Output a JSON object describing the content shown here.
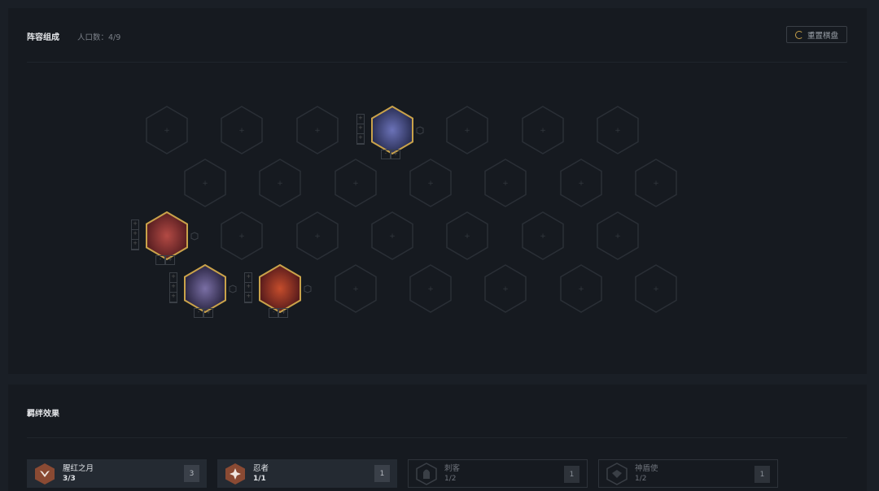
{
  "board": {
    "title": "阵容组成",
    "population_label": "人口数：4/9",
    "reset_label": "重置棋盘",
    "units": [
      {
        "name": "unit-1",
        "star": 1
      },
      {
        "name": "unit-2",
        "star": 1
      },
      {
        "name": "unit-3",
        "star": 1
      },
      {
        "name": "unit-4",
        "star": 1
      }
    ]
  },
  "traits": {
    "title": "羁绊效果",
    "items": [
      {
        "name": "腥红之月",
        "count": "3/3",
        "level": "3",
        "active": true,
        "icon": "moon-emblem-icon"
      },
      {
        "name": "忍者",
        "count": "1/1",
        "level": "1",
        "active": true,
        "icon": "shuriken-icon"
      },
      {
        "name": "刺客",
        "count": "1/2",
        "level": "1",
        "active": false,
        "icon": "assassin-icon"
      },
      {
        "name": "神盾使",
        "count": "1/2",
        "level": "1",
        "active": false,
        "icon": "aegis-icon"
      }
    ]
  },
  "colors": {
    "gold_border": "#c9a24a",
    "trait_bronze": "#8a4a33",
    "panel_bg": "#161a20"
  }
}
